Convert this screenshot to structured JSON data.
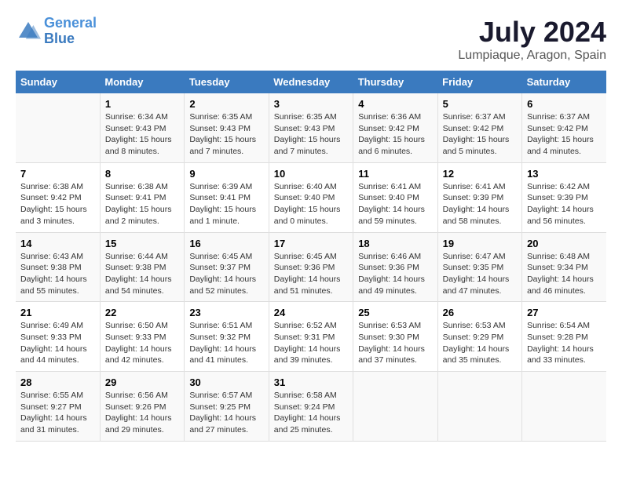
{
  "logo": {
    "line1": "General",
    "line2": "Blue"
  },
  "title": "July 2024",
  "subtitle": "Lumpiaque, Aragon, Spain",
  "days_of_week": [
    "Sunday",
    "Monday",
    "Tuesday",
    "Wednesday",
    "Thursday",
    "Friday",
    "Saturday"
  ],
  "weeks": [
    [
      {
        "day": "",
        "sunrise": "",
        "sunset": "",
        "daylight": ""
      },
      {
        "day": "1",
        "sunrise": "Sunrise: 6:34 AM",
        "sunset": "Sunset: 9:43 PM",
        "daylight": "Daylight: 15 hours and 8 minutes."
      },
      {
        "day": "2",
        "sunrise": "Sunrise: 6:35 AM",
        "sunset": "Sunset: 9:43 PM",
        "daylight": "Daylight: 15 hours and 7 minutes."
      },
      {
        "day": "3",
        "sunrise": "Sunrise: 6:35 AM",
        "sunset": "Sunset: 9:43 PM",
        "daylight": "Daylight: 15 hours and 7 minutes."
      },
      {
        "day": "4",
        "sunrise": "Sunrise: 6:36 AM",
        "sunset": "Sunset: 9:42 PM",
        "daylight": "Daylight: 15 hours and 6 minutes."
      },
      {
        "day": "5",
        "sunrise": "Sunrise: 6:37 AM",
        "sunset": "Sunset: 9:42 PM",
        "daylight": "Daylight: 15 hours and 5 minutes."
      },
      {
        "day": "6",
        "sunrise": "Sunrise: 6:37 AM",
        "sunset": "Sunset: 9:42 PM",
        "daylight": "Daylight: 15 hours and 4 minutes."
      }
    ],
    [
      {
        "day": "7",
        "sunrise": "Sunrise: 6:38 AM",
        "sunset": "Sunset: 9:42 PM",
        "daylight": "Daylight: 15 hours and 3 minutes."
      },
      {
        "day": "8",
        "sunrise": "Sunrise: 6:38 AM",
        "sunset": "Sunset: 9:41 PM",
        "daylight": "Daylight: 15 hours and 2 minutes."
      },
      {
        "day": "9",
        "sunrise": "Sunrise: 6:39 AM",
        "sunset": "Sunset: 9:41 PM",
        "daylight": "Daylight: 15 hours and 1 minute."
      },
      {
        "day": "10",
        "sunrise": "Sunrise: 6:40 AM",
        "sunset": "Sunset: 9:40 PM",
        "daylight": "Daylight: 15 hours and 0 minutes."
      },
      {
        "day": "11",
        "sunrise": "Sunrise: 6:41 AM",
        "sunset": "Sunset: 9:40 PM",
        "daylight": "Daylight: 14 hours and 59 minutes."
      },
      {
        "day": "12",
        "sunrise": "Sunrise: 6:41 AM",
        "sunset": "Sunset: 9:39 PM",
        "daylight": "Daylight: 14 hours and 58 minutes."
      },
      {
        "day": "13",
        "sunrise": "Sunrise: 6:42 AM",
        "sunset": "Sunset: 9:39 PM",
        "daylight": "Daylight: 14 hours and 56 minutes."
      }
    ],
    [
      {
        "day": "14",
        "sunrise": "Sunrise: 6:43 AM",
        "sunset": "Sunset: 9:38 PM",
        "daylight": "Daylight: 14 hours and 55 minutes."
      },
      {
        "day": "15",
        "sunrise": "Sunrise: 6:44 AM",
        "sunset": "Sunset: 9:38 PM",
        "daylight": "Daylight: 14 hours and 54 minutes."
      },
      {
        "day": "16",
        "sunrise": "Sunrise: 6:45 AM",
        "sunset": "Sunset: 9:37 PM",
        "daylight": "Daylight: 14 hours and 52 minutes."
      },
      {
        "day": "17",
        "sunrise": "Sunrise: 6:45 AM",
        "sunset": "Sunset: 9:36 PM",
        "daylight": "Daylight: 14 hours and 51 minutes."
      },
      {
        "day": "18",
        "sunrise": "Sunrise: 6:46 AM",
        "sunset": "Sunset: 9:36 PM",
        "daylight": "Daylight: 14 hours and 49 minutes."
      },
      {
        "day": "19",
        "sunrise": "Sunrise: 6:47 AM",
        "sunset": "Sunset: 9:35 PM",
        "daylight": "Daylight: 14 hours and 47 minutes."
      },
      {
        "day": "20",
        "sunrise": "Sunrise: 6:48 AM",
        "sunset": "Sunset: 9:34 PM",
        "daylight": "Daylight: 14 hours and 46 minutes."
      }
    ],
    [
      {
        "day": "21",
        "sunrise": "Sunrise: 6:49 AM",
        "sunset": "Sunset: 9:33 PM",
        "daylight": "Daylight: 14 hours and 44 minutes."
      },
      {
        "day": "22",
        "sunrise": "Sunrise: 6:50 AM",
        "sunset": "Sunset: 9:33 PM",
        "daylight": "Daylight: 14 hours and 42 minutes."
      },
      {
        "day": "23",
        "sunrise": "Sunrise: 6:51 AM",
        "sunset": "Sunset: 9:32 PM",
        "daylight": "Daylight: 14 hours and 41 minutes."
      },
      {
        "day": "24",
        "sunrise": "Sunrise: 6:52 AM",
        "sunset": "Sunset: 9:31 PM",
        "daylight": "Daylight: 14 hours and 39 minutes."
      },
      {
        "day": "25",
        "sunrise": "Sunrise: 6:53 AM",
        "sunset": "Sunset: 9:30 PM",
        "daylight": "Daylight: 14 hours and 37 minutes."
      },
      {
        "day": "26",
        "sunrise": "Sunrise: 6:53 AM",
        "sunset": "Sunset: 9:29 PM",
        "daylight": "Daylight: 14 hours and 35 minutes."
      },
      {
        "day": "27",
        "sunrise": "Sunrise: 6:54 AM",
        "sunset": "Sunset: 9:28 PM",
        "daylight": "Daylight: 14 hours and 33 minutes."
      }
    ],
    [
      {
        "day": "28",
        "sunrise": "Sunrise: 6:55 AM",
        "sunset": "Sunset: 9:27 PM",
        "daylight": "Daylight: 14 hours and 31 minutes."
      },
      {
        "day": "29",
        "sunrise": "Sunrise: 6:56 AM",
        "sunset": "Sunset: 9:26 PM",
        "daylight": "Daylight: 14 hours and 29 minutes."
      },
      {
        "day": "30",
        "sunrise": "Sunrise: 6:57 AM",
        "sunset": "Sunset: 9:25 PM",
        "daylight": "Daylight: 14 hours and 27 minutes."
      },
      {
        "day": "31",
        "sunrise": "Sunrise: 6:58 AM",
        "sunset": "Sunset: 9:24 PM",
        "daylight": "Daylight: 14 hours and 25 minutes."
      },
      {
        "day": "",
        "sunrise": "",
        "sunset": "",
        "daylight": ""
      },
      {
        "day": "",
        "sunrise": "",
        "sunset": "",
        "daylight": ""
      },
      {
        "day": "",
        "sunrise": "",
        "sunset": "",
        "daylight": ""
      }
    ]
  ]
}
